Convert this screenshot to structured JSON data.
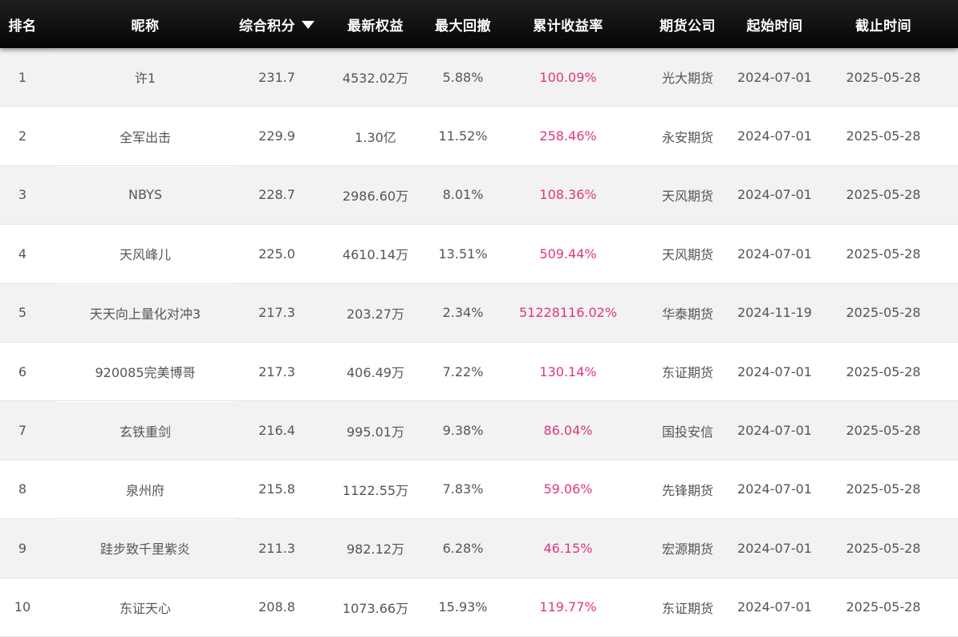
{
  "header": {
    "rank": "排名",
    "name": "昵称",
    "score": "综合积分",
    "equity": "最新权益",
    "drawdown": "最大回撤",
    "return": "累计收益率",
    "company": "期货公司",
    "start": "起始时间",
    "end": "截止时间",
    "sort_icon": "caret-down-icon"
  },
  "colors": {
    "header_bg": "#111111",
    "return_text": "#e0357f",
    "stripe": "#f2f2f2"
  },
  "rows": [
    {
      "rank": "1",
      "name": "许1",
      "score": "231.7",
      "equity": "4532.02万",
      "drawdown": "5.88%",
      "return": "100.09%",
      "company": "光大期货",
      "start": "2024-07-01",
      "end": "2025-05-28"
    },
    {
      "rank": "2",
      "name": "全军出击",
      "score": "229.9",
      "equity": "1.30亿",
      "drawdown": "11.52%",
      "return": "258.46%",
      "company": "永安期货",
      "start": "2024-07-01",
      "end": "2025-05-28"
    },
    {
      "rank": "3",
      "name": "NBYS",
      "score": "228.7",
      "equity": "2986.60万",
      "drawdown": "8.01%",
      "return": "108.36%",
      "company": "天风期货",
      "start": "2024-07-01",
      "end": "2025-05-28"
    },
    {
      "rank": "4",
      "name": "天风峰儿",
      "score": "225.0",
      "equity": "4610.14万",
      "drawdown": "13.51%",
      "return": "509.44%",
      "company": "天风期货",
      "start": "2024-07-01",
      "end": "2025-05-28"
    },
    {
      "rank": "5",
      "name": "天天向上量化对冲3",
      "score": "217.3",
      "equity": "203.27万",
      "drawdown": "2.34%",
      "return": "51228116.02%",
      "company": "华泰期货",
      "start": "2024-11-19",
      "end": "2025-05-28"
    },
    {
      "rank": "6",
      "name": "920085完美博哥",
      "score": "217.3",
      "equity": "406.49万",
      "drawdown": "7.22%",
      "return": "130.14%",
      "company": "东证期货",
      "start": "2024-07-01",
      "end": "2025-05-28"
    },
    {
      "rank": "7",
      "name": "玄铁重剑",
      "score": "216.4",
      "equity": "995.01万",
      "drawdown": "9.38%",
      "return": "86.04%",
      "company": "国投安信",
      "start": "2024-07-01",
      "end": "2025-05-28"
    },
    {
      "rank": "8",
      "name": "泉州府",
      "score": "215.8",
      "equity": "1122.55万",
      "drawdown": "7.83%",
      "return": "59.06%",
      "company": "先锋期货",
      "start": "2024-07-01",
      "end": "2025-05-28"
    },
    {
      "rank": "9",
      "name": "跬步致千里紫炎",
      "score": "211.3",
      "equity": "982.12万",
      "drawdown": "6.28%",
      "return": "46.15%",
      "company": "宏源期货",
      "start": "2024-07-01",
      "end": "2025-05-28"
    },
    {
      "rank": "10",
      "name": "东证天心",
      "score": "208.8",
      "equity": "1073.66万",
      "drawdown": "15.93%",
      "return": "119.77%",
      "company": "东证期货",
      "start": "2024-07-01",
      "end": "2025-05-28"
    }
  ]
}
